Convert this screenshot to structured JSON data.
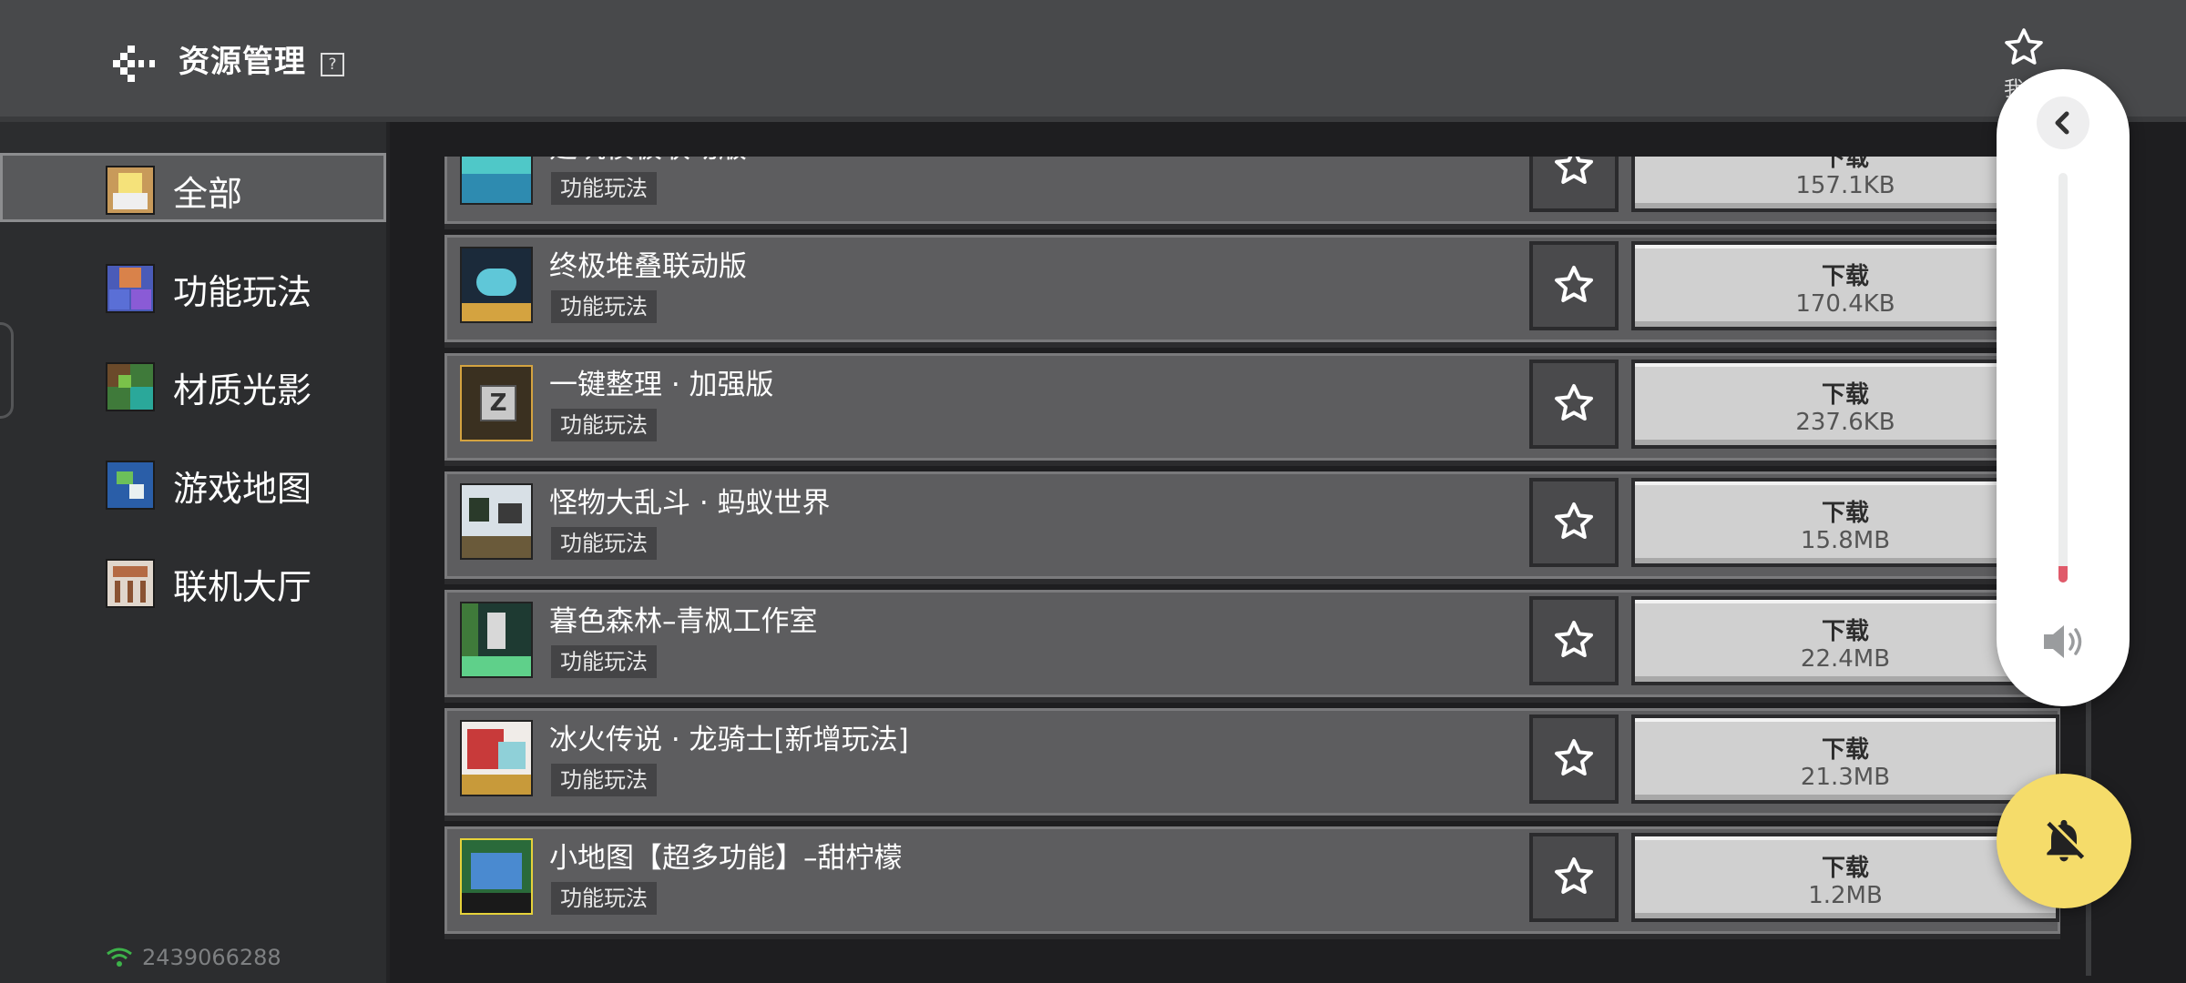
{
  "header": {
    "title": "资源管理",
    "help_label": "?",
    "my_favorites_label": "我的"
  },
  "sidebar": {
    "items": [
      {
        "label": "全部",
        "icon": "all-icon",
        "active": true
      },
      {
        "label": "功能玩法",
        "icon": "gameplay-icon",
        "active": false
      },
      {
        "label": "材质光影",
        "icon": "texture-icon",
        "active": false
      },
      {
        "label": "游戏地图",
        "icon": "map-icon",
        "active": false
      },
      {
        "label": "联机大厅",
        "icon": "lobby-icon",
        "active": false
      }
    ],
    "footer_id": "2439066288"
  },
  "list": {
    "download_label": "下载",
    "items": [
      {
        "title": "建筑模板联动版",
        "tag": "功能玩法",
        "size": "157.1KB"
      },
      {
        "title": "终极堆叠联动版",
        "tag": "功能玩法",
        "size": "170.4KB"
      },
      {
        "title": "一键整理 · 加强版",
        "tag": "功能玩法",
        "size": "237.6KB"
      },
      {
        "title": "怪物大乱斗 · 蚂蚁世界",
        "tag": "功能玩法",
        "size": "15.8MB"
      },
      {
        "title": "暮色森林–青枫工作室",
        "tag": "功能玩法",
        "size": "22.4MB"
      },
      {
        "title": "冰火传说 · 龙骑士[新增玩法]",
        "tag": "功能玩法",
        "size": "21.3MB"
      },
      {
        "title": "小地图【超多功能】–甜柠檬",
        "tag": "功能玩法",
        "size": "1.2MB"
      }
    ]
  },
  "volume_panel": {
    "level": 0.04,
    "accent_color": "#e05a6a"
  },
  "mute_button": {
    "icon": "bell-off-icon",
    "color": "#f5dc6a"
  }
}
